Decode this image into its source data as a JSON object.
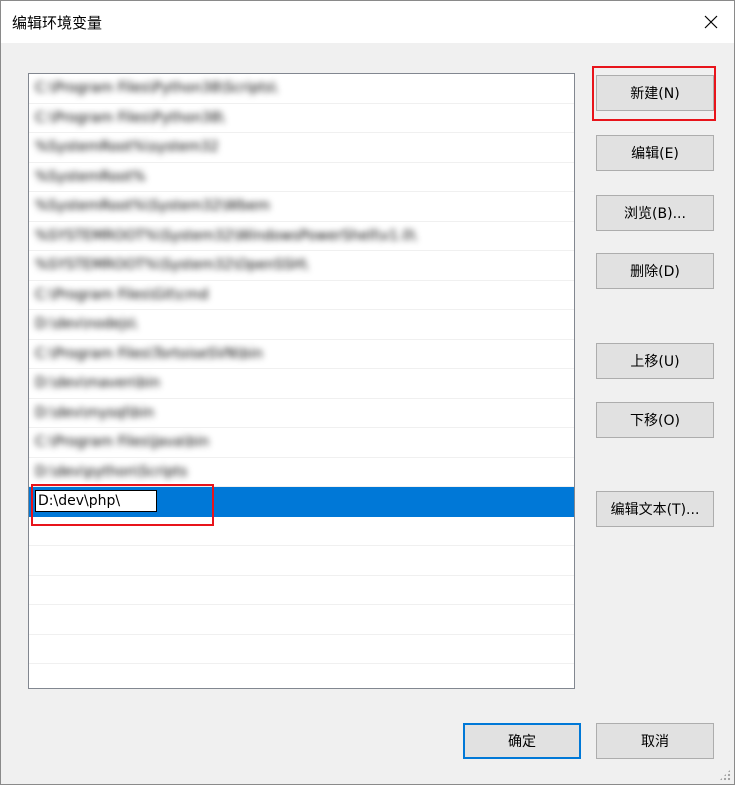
{
  "window": {
    "title": "编辑环境变量",
    "close_glyph": "✕"
  },
  "list": {
    "entries": [
      "C:\\Program Files\\Python38\\Scripts\\",
      "C:\\Program Files\\Python38\\",
      "%SystemRoot%\\system32",
      "%SystemRoot%",
      "%SystemRoot%\\System32\\Wbem",
      "%SYSTEMROOT%\\System32\\WindowsPowerShell\\v1.0\\",
      "%SYSTEMROOT%\\System32\\OpenSSH\\",
      "C:\\Program Files\\Git\\cmd",
      "D:\\dev\\nodejs\\",
      "C:\\Program Files\\TortoiseSVN\\bin",
      "D:\\dev\\maven\\bin",
      "D:\\dev\\mysql\\bin",
      "C:\\Program Files\\Java\\bin",
      "D:\\dev\\python\\Scripts"
    ],
    "editing_value": "D:\\dev\\php\\"
  },
  "buttons": {
    "new": "新建(N)",
    "edit": "编辑(E)",
    "browse": "浏览(B)...",
    "delete": "删除(D)",
    "move_up": "上移(U)",
    "move_down": "下移(O)",
    "edit_text": "编辑文本(T)...",
    "ok": "确定",
    "cancel": "取消"
  },
  "colors": {
    "selection": "#0078d7",
    "highlight": "#e8141b"
  }
}
